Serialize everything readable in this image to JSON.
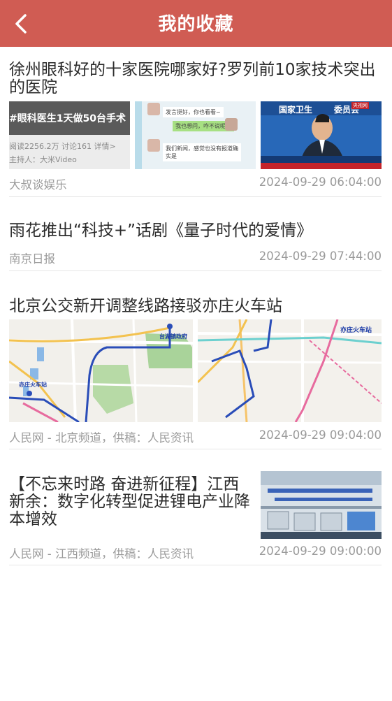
{
  "header": {
    "title": "我的收藏",
    "back_icon": "chevron-left-icon",
    "color": "#d05c53"
  },
  "articles": [
    {
      "title": "徐州眼科好的十家医院哪家好?罗列前10家技术突出的医院",
      "source": "大叔谈娱乐",
      "time": "2024-09-29 06:04:00",
      "thumbs": {
        "a": {
          "banner": "#眼科医生1天做50台手术",
          "stats": "阅读2256.2万  讨论161  详情>",
          "host": "主持人：大米Video"
        },
        "b": {
          "chat1": "发言挺好，你也看看~",
          "chat2": "我也想问，咋不说呢？",
          "chat3": "我们新闻，感觉也没有报道确实是"
        },
        "c": {
          "backdrop": "国家卫生",
          "backdrop2": "委员会",
          "tag": "央视网"
        }
      }
    },
    {
      "title": "雨花推出“科技+”话剧《量子时代的爱情》",
      "source": "南京日报",
      "time": "2024-09-29 07:44:00"
    },
    {
      "title": "北京公交新开调整线路接驳亦庄火车站",
      "source": "人民网 - 北京频道，供稿：人民资讯",
      "time": "2024-09-29 09:04:00",
      "maps": {
        "left_label1": "台湖镇政府",
        "left_label2": "亦庄火车站",
        "right_label1": "亦庄火车站"
      }
    },
    {
      "title": "【不忘来时路 奋进新征程】江西新余：数字化转型促进锂电产业降本增效",
      "source": "人民网 - 江西频道，供稿：人民资讯",
      "time": "2024-09-29 09:00:00"
    }
  ]
}
